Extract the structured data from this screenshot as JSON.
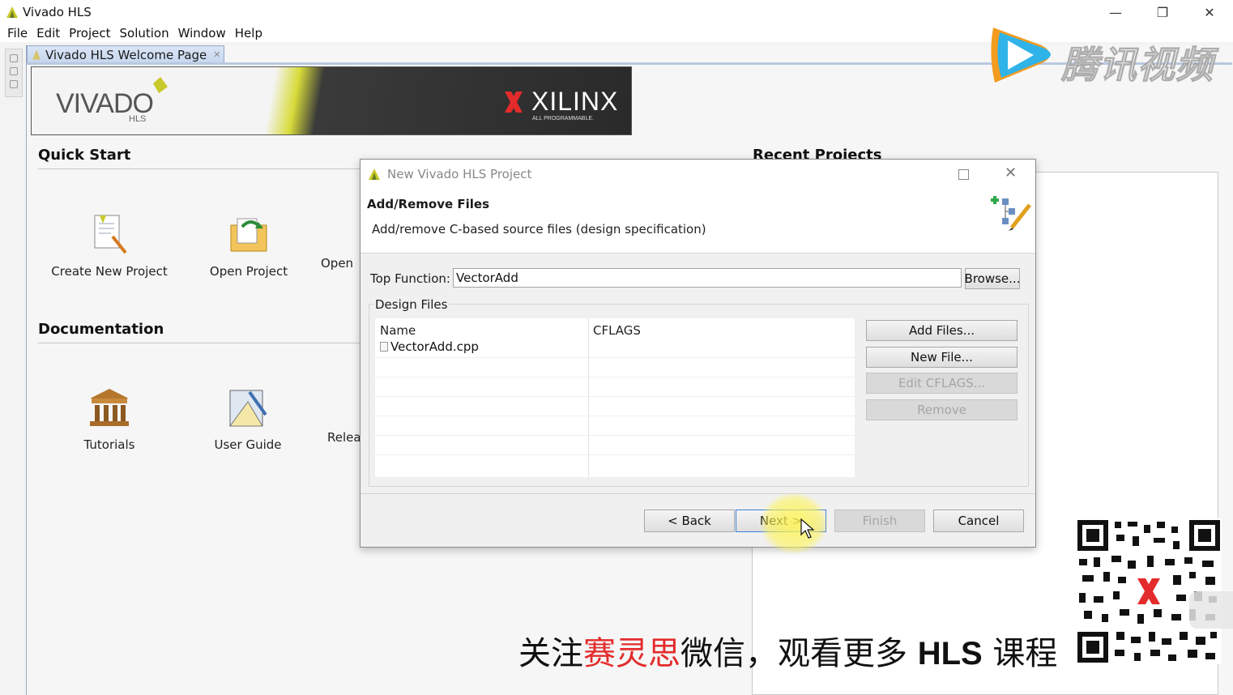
{
  "window": {
    "title": "Vivado HLS"
  },
  "menu": [
    "File",
    "Edit",
    "Project",
    "Solution",
    "Window",
    "Help"
  ],
  "editor_tab": {
    "label": "Vivado HLS Welcome Page"
  },
  "banner": {
    "product": "VIVADO",
    "product_sub": "HLS",
    "vendor": "XILINX",
    "vendor_tagline": "ALL PROGRAMMABLE."
  },
  "quick_start": {
    "title": "Quick Start",
    "items": [
      "Create New Project",
      "Open Project",
      "Open"
    ]
  },
  "documentation": {
    "title": "Documentation",
    "items": [
      "Tutorials",
      "User Guide",
      "Relea"
    ]
  },
  "recent_projects": {
    "title": "Recent Projects"
  },
  "dialog": {
    "title": "New Vivado HLS Project",
    "header_title": "Add/Remove Files",
    "header_desc": "Add/remove C-based source files (design specification)",
    "top_function_label": "Top Function:",
    "top_function_value": "VectorAdd",
    "browse_label": "Browse...",
    "design_files_label": "Design Files",
    "table": {
      "columns": [
        "Name",
        "CFLAGS"
      ],
      "rows": [
        {
          "name": "VectorAdd.cpp",
          "cflags": ""
        }
      ]
    },
    "side_buttons": {
      "add_files": "Add Files...",
      "new_file": "New File...",
      "edit_cflags": "Edit CFLAGS...",
      "remove": "Remove"
    },
    "footer": {
      "back": "< Back",
      "next": "Next >",
      "finish": "Finish",
      "cancel": "Cancel"
    }
  },
  "watermark": {
    "text": "腾讯视频"
  },
  "caption": {
    "part1": "关注",
    "part2": "赛灵思",
    "part3": "微信，观看更多 ",
    "part4": "HLS",
    "part5": " 课程"
  },
  "colors": {
    "accent": "#e32b2b",
    "xilinx_red": "#e32b2b",
    "vivado_leaf": "#c8c92a",
    "highlight": "#fff550"
  }
}
